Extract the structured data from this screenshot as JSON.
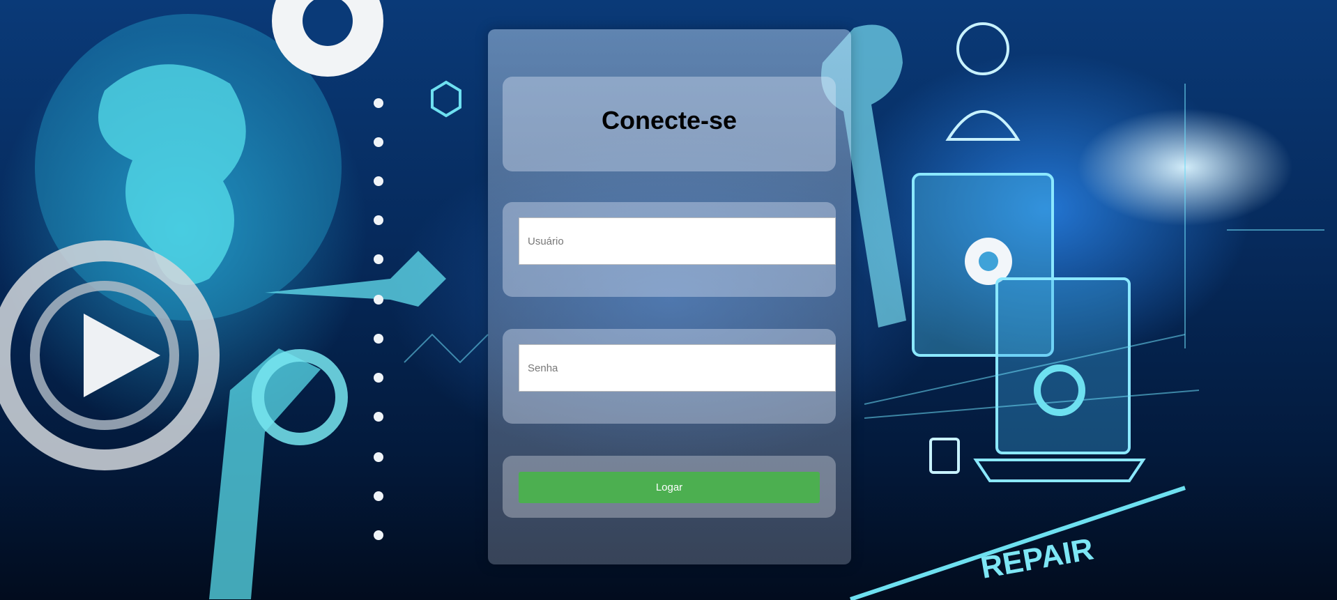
{
  "login": {
    "title": "Conecte-se",
    "username_placeholder": "Usuário",
    "password_placeholder": "Senha",
    "submit_label": "Logar"
  },
  "colors": {
    "button": "#4caf50",
    "background": "#0a3a78"
  }
}
